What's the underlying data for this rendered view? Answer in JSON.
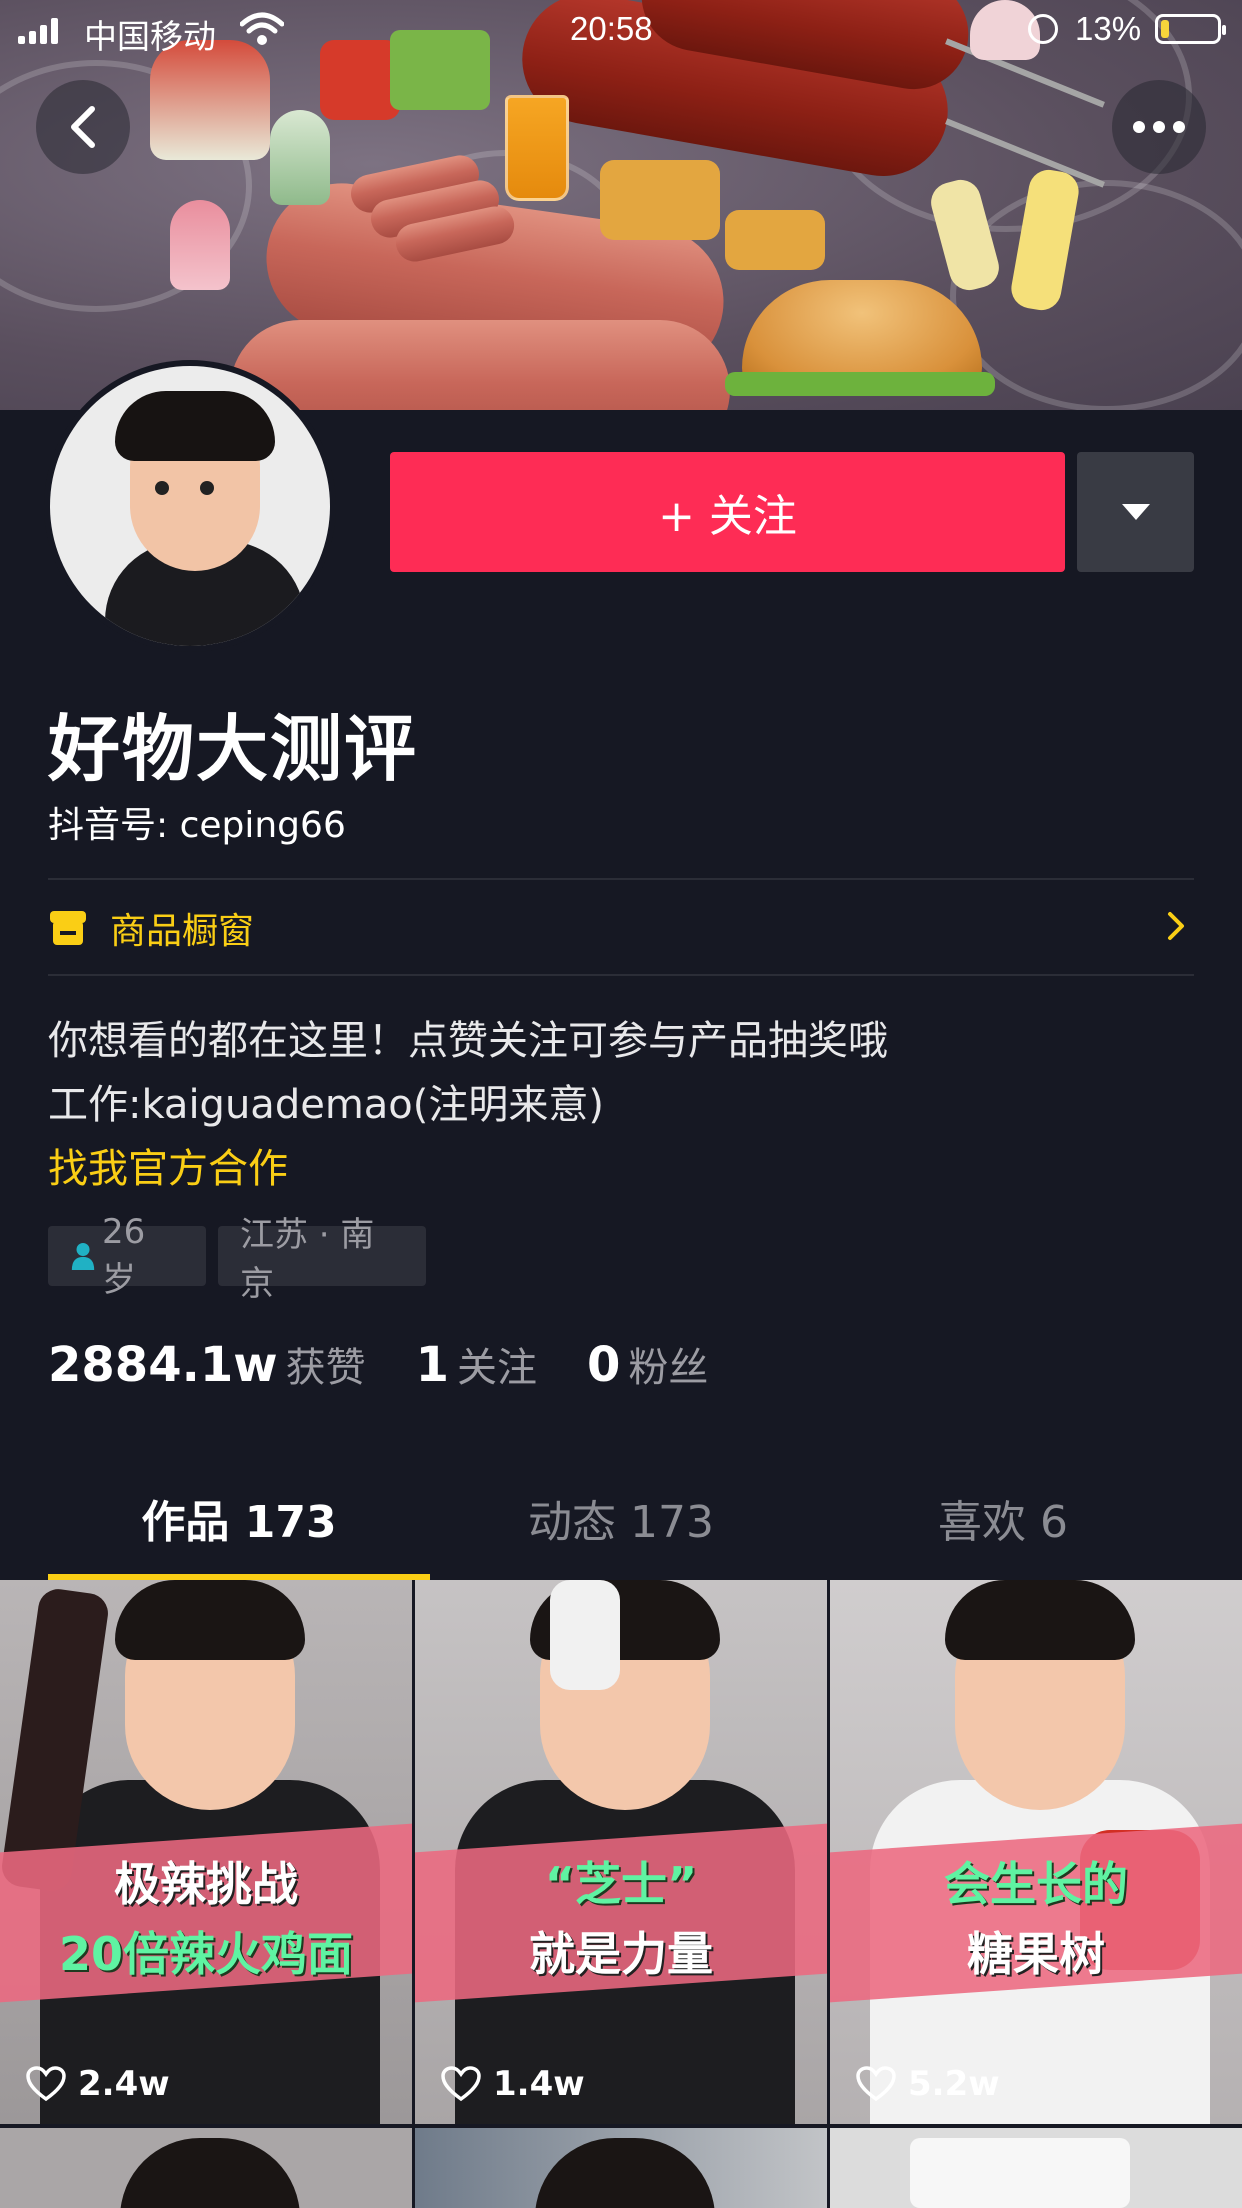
{
  "status_bar": {
    "carrier": "中国移动",
    "time": "20:58",
    "battery": "13%"
  },
  "profile": {
    "name": "好物大测评",
    "douyin_id": "抖音号: ceping66",
    "follow_label": "+ 关注",
    "shop_label": "商品橱窗",
    "bio_line1": "你想看的都在这里！点赞关注可参与产品抽奖哦",
    "bio_line2": "工作:kaiguademao(注明来意)",
    "bio_link": "找我官方合作",
    "tags": {
      "age": "26 岁",
      "location": "江苏 · 南京"
    }
  },
  "stats": {
    "likes_count": "2884.1w",
    "likes_label": "获赞",
    "following_count": "1",
    "following_label": "关注",
    "followers_count": "0",
    "followers_label": "粉丝"
  },
  "tabs": [
    {
      "label": "作品 173"
    },
    {
      "label": "动态 173"
    },
    {
      "label": "喜欢 6"
    }
  ],
  "videos": [
    {
      "caption1": "极辣挑战",
      "caption2": "20倍辣火鸡面",
      "likes": "2.4w"
    },
    {
      "caption1": "“芝士”",
      "caption2": "就是力量",
      "likes": "1.4w"
    },
    {
      "caption1": "会生长的",
      "caption2": "糖果树",
      "likes": "5.2w"
    }
  ],
  "colors": {
    "background": "#161823",
    "follow_button": "#fe2c55",
    "accent_yellow": "#face15"
  }
}
